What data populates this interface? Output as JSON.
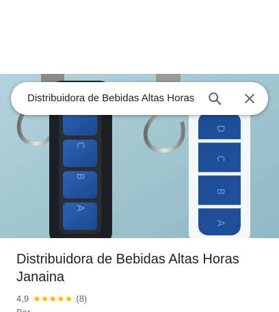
{
  "search": {
    "query": "Distribuidora de Bebidas Altas Horas Janaina",
    "search_icon": "search-icon",
    "close_icon": "close-icon"
  },
  "hero": {
    "photo": "remote controls with blue buttons A B C D on light blue background"
  },
  "place": {
    "name": "Distribuidora de Bebidas Altas Horas Janaina",
    "rating": "4,9",
    "rating_value": 4.9,
    "stars_shown": 5,
    "review_count": "(8)",
    "category": "Bar"
  },
  "colors": {
    "star": "#f4b400",
    "text_primary": "#202124",
    "text_secondary": "#5f6368"
  }
}
